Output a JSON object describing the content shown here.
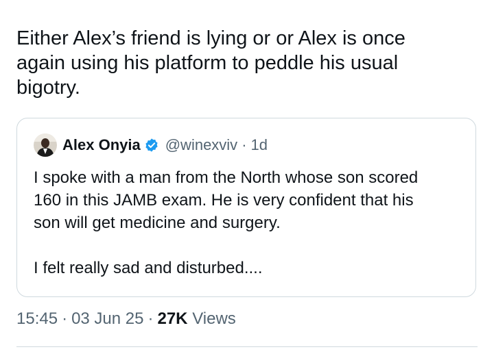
{
  "tweet": {
    "text": "Either Alex’s friend is lying or or Alex is once\nagain using his platform to peddle his usual\nbigotry."
  },
  "quote": {
    "author_name": "Alex Onyia",
    "handle": "@winexviv",
    "separator": "·",
    "time_ago": "1d",
    "text": "I spoke with a man from the North whose son scored\n160 in this JAMB exam. He is very confident that his\nson will get medicine and surgery.\n\nI felt really sad and disturbed....",
    "avatar_icon": "profile-photo-icon",
    "verified_icon": "verified-badge-icon"
  },
  "meta": {
    "time": "15:45",
    "date": "03 Jun 25",
    "separator": "·",
    "views_count": "27K",
    "views_label": "Views"
  },
  "colors": {
    "text_primary": "#0f1419",
    "text_secondary": "#536471",
    "border": "#cfd9de",
    "verified": "#1d9bf0"
  }
}
